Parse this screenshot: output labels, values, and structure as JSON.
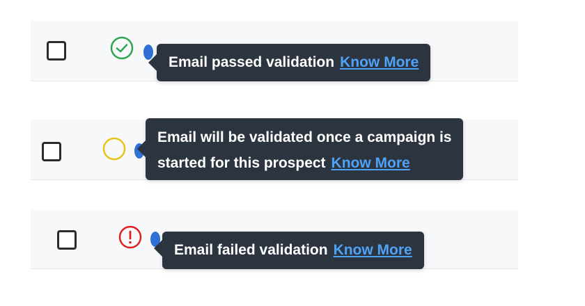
{
  "rows": [
    {
      "status": "passed",
      "status_icon": "check-circle-icon",
      "status_color": "#2ea44f",
      "tooltip_text": "Email passed validation",
      "link_label": "Know More"
    },
    {
      "status": "pending",
      "status_icon": "empty-circle-icon",
      "status_color": "#e8c31a",
      "tooltip_line1": "Email will be validated once a campaign is",
      "tooltip_line2": "started for this prospect",
      "link_label": "Know More"
    },
    {
      "status": "failed",
      "status_icon": "exclamation-circle-icon",
      "status_color": "#e02020",
      "tooltip_text": "Email failed validation",
      "link_label": "Know More"
    }
  ],
  "colors": {
    "tooltip_bg": "#2c3440",
    "link": "#4fa3f7",
    "row_bg": "#f7f8f9"
  }
}
